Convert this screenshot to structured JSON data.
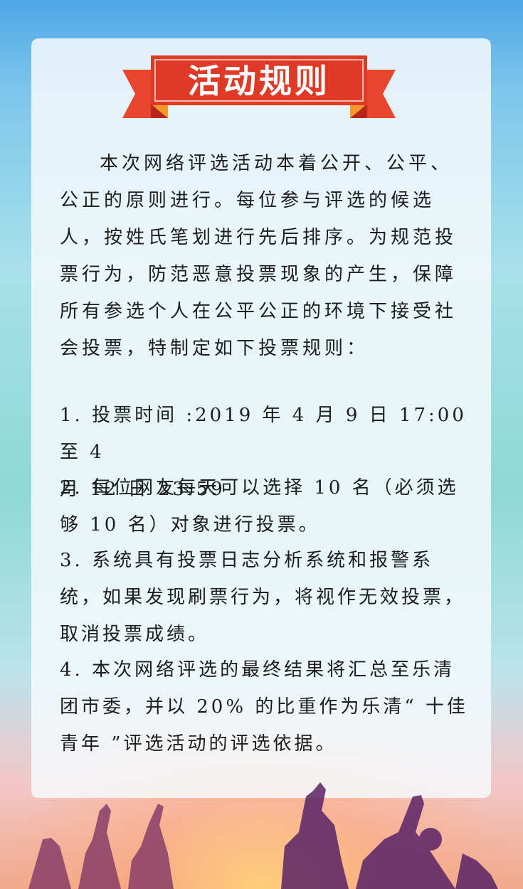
{
  "banner": {
    "title": "活动规则",
    "color": "#e03a27",
    "fold_color": "#b8261a",
    "ribbon_tail_color": "#e8452e"
  },
  "intro": {
    "lines": [
      "本次网络评选活动本着公开、公平、",
      "公正的原则进行。每位参与评选的候选",
      "人，按姓氏笔划进行先后排序。为规范投",
      "票行为，防范恶意投票现象的产生，保障",
      "所有参选个人在公平公正的环境下接受社",
      "会投票，特制定如下投票规则："
    ]
  },
  "rules": [
    {
      "lines": [
        "1. 投票时间 :2019 年 4 月 9 日 17:00 至 4",
        "月 12 日 23:59"
      ]
    },
    {
      "lines": [
        "2. 每位网友每天可以选择 10 名（必须选",
        "够 10 名）对象进行投票。"
      ]
    },
    {
      "lines": [
        "3. 系统具有投票日志分析系统和报警系",
        "统，如果发现刷票行为，将视作无效投票，",
        "取消投票成绩。"
      ]
    },
    {
      "lines": [
        "4. 本次网络评选的最终结果将汇总至乐清",
        "团市委，并以 20% 的比重作为乐清“ 十佳",
        "青年 ”评选活动的评选依据。"
      ]
    }
  ]
}
